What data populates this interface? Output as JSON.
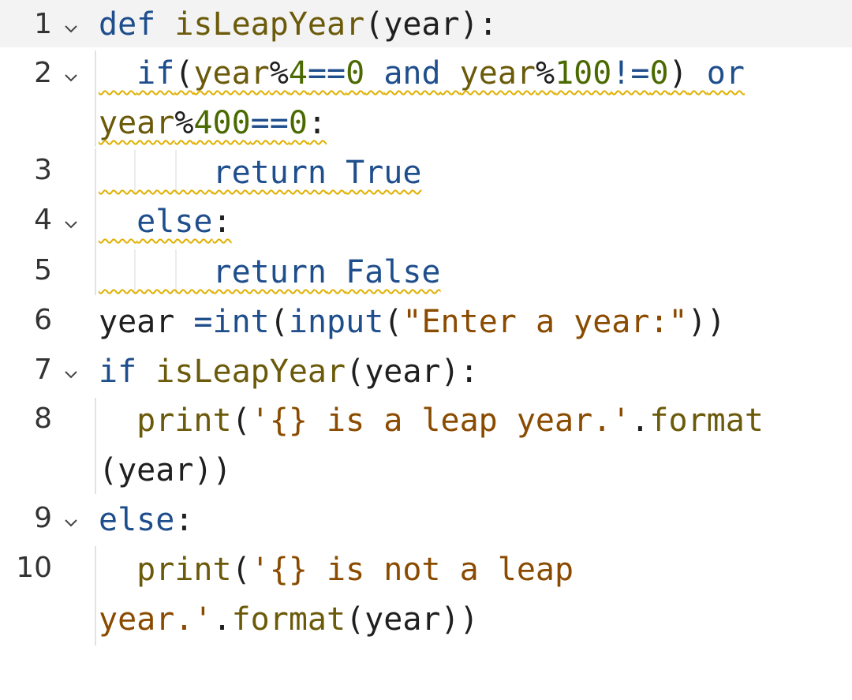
{
  "editor": {
    "line_numbers": [
      "1",
      "2",
      "3",
      "4",
      "5",
      "6",
      "7",
      "8",
      "9",
      "10"
    ],
    "folds": [
      "1",
      "2",
      "4",
      "7",
      "9"
    ],
    "lines": {
      "l1": {
        "def": "def",
        "name": "isLeapYear",
        "open": "(",
        "arg": "year",
        "close": "):"
      },
      "l2": {
        "if": "if",
        "open": "(",
        "year1": "year",
        "mod1": "%",
        "n4": "4",
        "eq1": "==",
        "z1": "0",
        "and": "and",
        "year2": "year",
        "mod2": "%",
        "n100": "100",
        "ne": "!=",
        "z2": "0",
        "close": ")",
        "or": "or"
      },
      "l2b": {
        "year3": "year",
        "mod3": "%",
        "n400": "400",
        "eq2": "==",
        "z3": "0",
        "colon": ":"
      },
      "l3": {
        "return": "return",
        "val": "True"
      },
      "l4": {
        "else": "else",
        "colon": ":"
      },
      "l5": {
        "return": "return",
        "val": "False"
      },
      "l6": {
        "year": "year",
        "assign": "=",
        "int": "int",
        "p1": "(",
        "input": "input",
        "p2": "(",
        "str": "\"Enter a year:\"",
        "p3": "))"
      },
      "l7": {
        "if": "if",
        "name": "isLeapYear",
        "open": "(",
        "arg": "year",
        "close": "):"
      },
      "l8": {
        "print": "print",
        "open": "(",
        "str": "'{} is a leap year.'",
        "dot": ".",
        "format": "format"
      },
      "l8b": {
        "args": "(year))"
      },
      "l9": {
        "else": "else",
        "colon": ":"
      },
      "l10": {
        "print": "print",
        "open": "(",
        "str": "'{} is not a leap"
      },
      "l10b": {
        "str": "year.'",
        "dot": ".",
        "format": "format",
        "args": "(year))"
      }
    }
  },
  "colors": {
    "keyword": "#1f4e8c",
    "function": "#6b5a0a",
    "number": "#4a6a00",
    "string": "#8a4b00",
    "warning_squiggle": "#e0b000",
    "current_line": "#f3f3f3"
  }
}
